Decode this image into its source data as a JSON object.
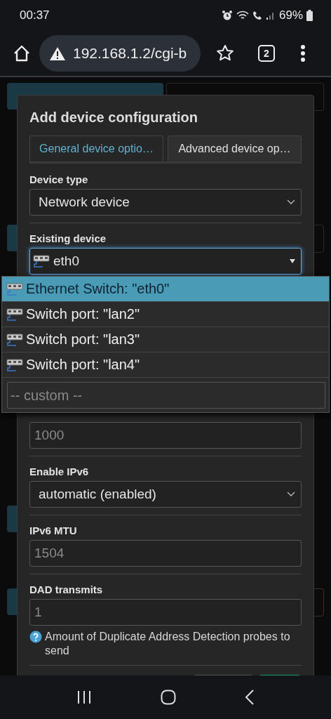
{
  "status_bar": {
    "time": "00:37",
    "battery": "69%"
  },
  "browser": {
    "url": "192.168.1.2/cgi-b",
    "tab_count": "2"
  },
  "dialog": {
    "title": "Add device configuration",
    "tabs": [
      {
        "label": "General device optio…",
        "selected": true
      },
      {
        "label": "Advanced device op…",
        "selected": false
      }
    ],
    "fields": [
      {
        "kind": "select",
        "label": "Device type",
        "value": "Network device"
      },
      {
        "kind": "device-select",
        "label": "Existing device",
        "value": "eth0"
      },
      {
        "kind": "input",
        "placeholder": "1000"
      },
      {
        "kind": "select",
        "label": "Enable IPv6",
        "value": "automatic (enabled)"
      },
      {
        "kind": "input",
        "label": "IPv6 MTU",
        "placeholder": "1504"
      },
      {
        "kind": "input",
        "label": "DAD transmits",
        "placeholder": "1",
        "help": "Amount of Duplicate Address Detection probes to send"
      }
    ]
  },
  "dropdown": {
    "options": [
      {
        "label": "Ethernet Switch: \"eth0\"",
        "selected": true
      },
      {
        "label": "Switch port: \"lan2\"",
        "selected": false
      },
      {
        "label": "Switch port: \"lan3\"",
        "selected": false
      },
      {
        "label": "Switch port: \"lan4\"",
        "selected": false
      }
    ],
    "custom_placeholder": "-- custom --"
  }
}
